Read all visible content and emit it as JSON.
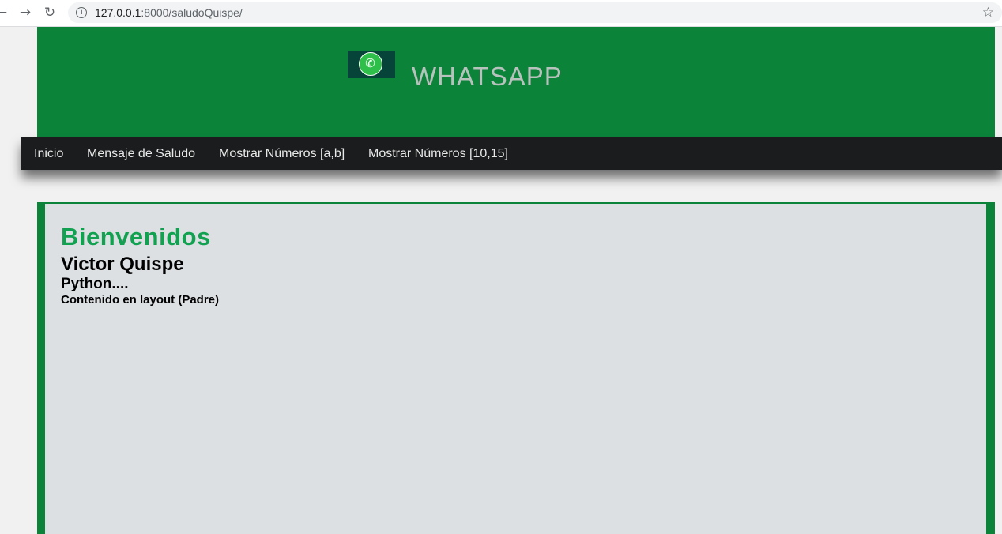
{
  "browser": {
    "url_host": "127.0.0.1",
    "url_rest": ":8000/saludoQuispe/"
  },
  "header": {
    "title": "WHATSAPP",
    "logo_icon": "whatsapp-logo"
  },
  "menu": {
    "items": [
      {
        "label": "Inicio"
      },
      {
        "label": "Mensaje de Saludo"
      },
      {
        "label": "Mostrar Números [a,b]"
      },
      {
        "label": "Mostrar Números [10,15]"
      }
    ]
  },
  "content": {
    "welcome": "Bienvenidos",
    "name": "Victor Quispe",
    "subtitle": "Python....",
    "note": "Contenido en layout (Padre)"
  },
  "colors": {
    "header_green": "#0b843a",
    "welcome_green": "#12a150",
    "menu_bg": "#1b1c1d",
    "panel_bg": "#dce0e3"
  }
}
